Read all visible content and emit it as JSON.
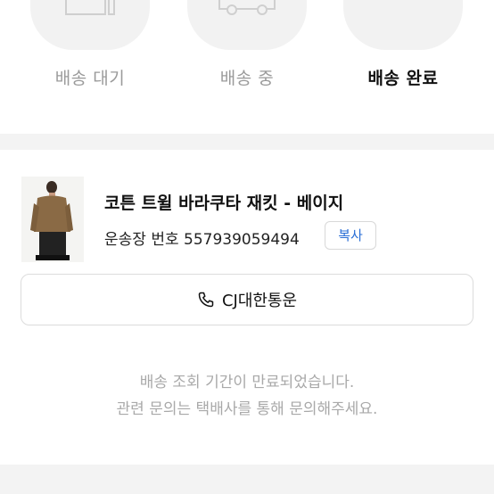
{
  "steps": [
    {
      "label": "배송 대기",
      "icon": "box-icon",
      "active": false
    },
    {
      "label": "배송 중",
      "icon": "truck-icon",
      "active": false
    },
    {
      "label": "배송 완료",
      "icon": "check-icon",
      "active": true
    }
  ],
  "product": {
    "name": "코튼 트윌 바라쿠타 재킷 - 베이지",
    "tracking_label": "운송장 번호",
    "tracking_number": "557939059494",
    "copy_label": "복사",
    "image_icon": "product-photo"
  },
  "carrier": {
    "icon": "phone-icon",
    "label": "CJ대한통운"
  },
  "notice": {
    "line1": "배송 조회 기간이 만료되었습니다.",
    "line2": "관련 문의는 택배사를 통해 문의해주세요."
  },
  "colors": {
    "accent": "#2b6fd6",
    "muted": "#9a9a9a",
    "divider": "#f3f3f3"
  }
}
